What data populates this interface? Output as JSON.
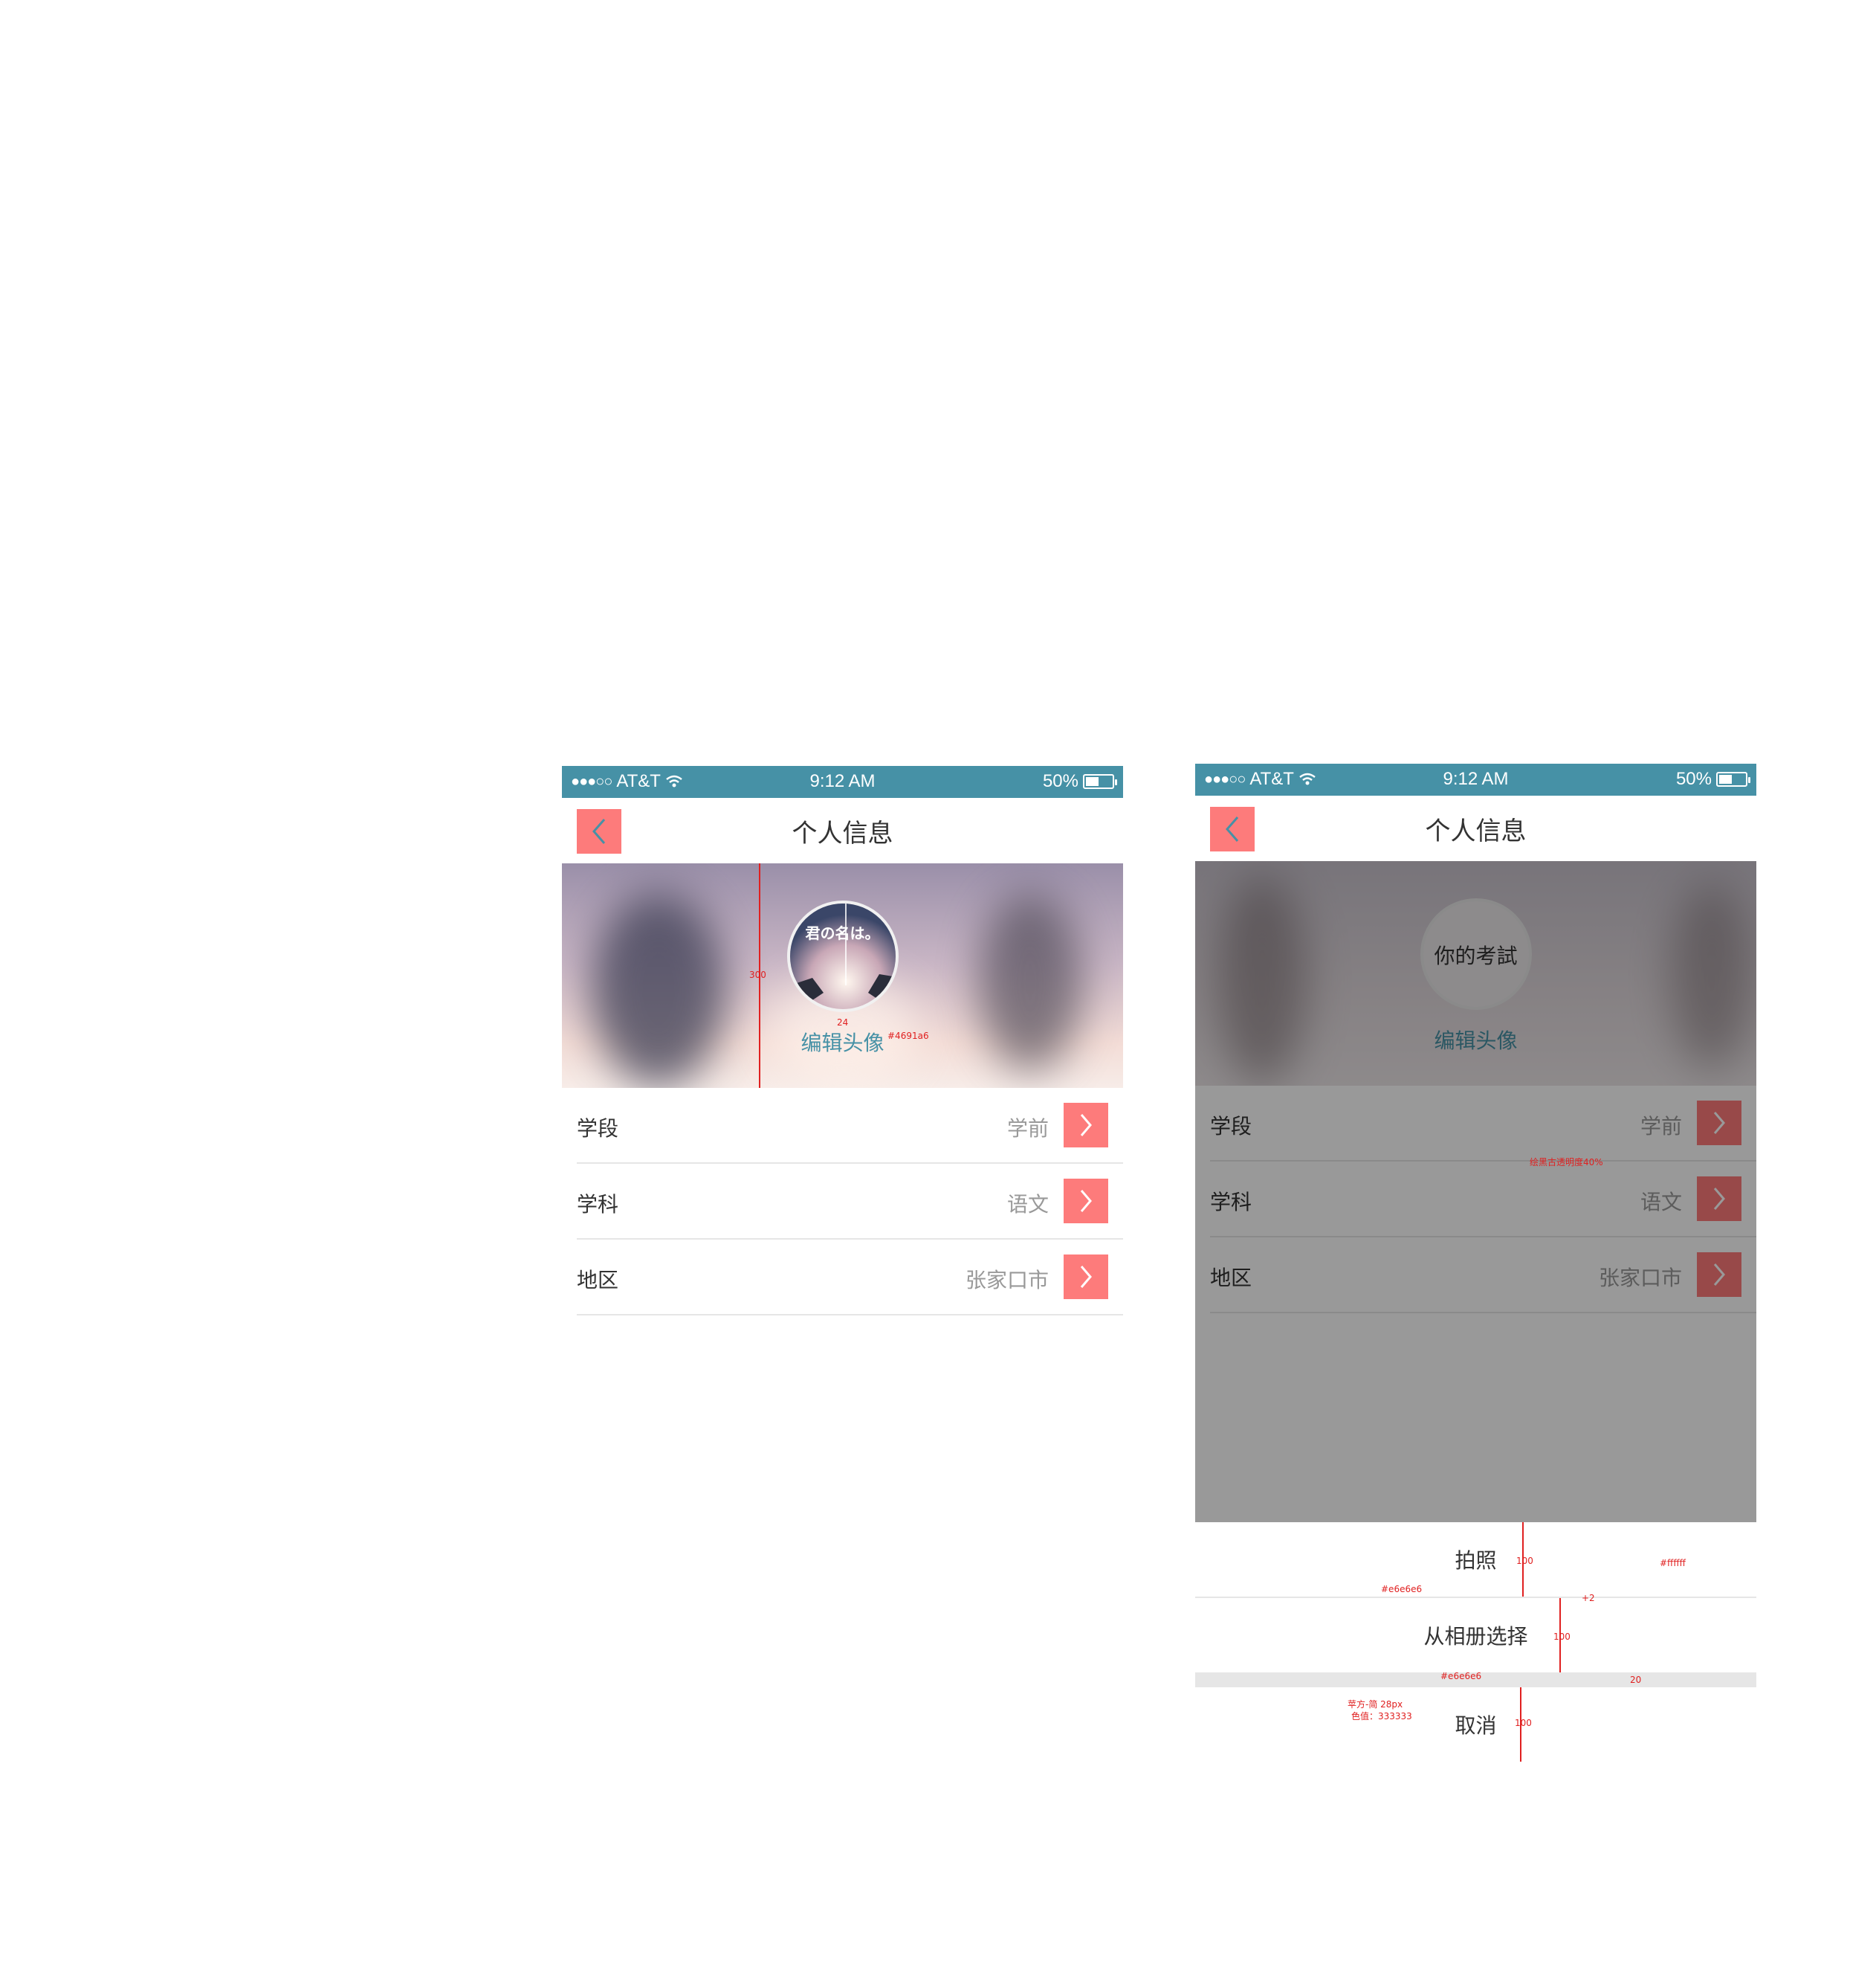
{
  "statusbar": {
    "carrier": "AT&T",
    "signal_dots": "●●●○○",
    "time": "9:12 AM",
    "battery": "50%",
    "battery_level": 0.5
  },
  "navbar": {
    "title": "个人信息"
  },
  "profile": {
    "avatar_title": "君の名は。",
    "edit_label": "编辑头像"
  },
  "profile_b": {
    "avatar_title": "你的考試",
    "edit_label": "编辑头像"
  },
  "list": [
    {
      "label": "学段",
      "value": "学前"
    },
    {
      "label": "学科",
      "value": "语文"
    },
    {
      "label": "地区",
      "value": "张家口市"
    }
  ],
  "sheet": {
    "take_photo": "拍照",
    "from_album": "从相册选择",
    "cancel": "取消"
  },
  "annotations": {
    "banner_height": "300",
    "avatar_gap": "24",
    "edit_color": "#4691a6",
    "overlay_note": "绘黑古透明度40%",
    "sheet_item_height_1": "100",
    "sheet_item_height_2": "100",
    "sheet_item_height_3": "100",
    "divider_thickness": "+2",
    "gap_height": "20",
    "sheet_bg": "#ffffff",
    "divider_color": "#e6e6e6",
    "gap_color": "#e6e6e6",
    "font_spec_1": "苹方-简   28px",
    "font_spec_2": "色值：333333"
  },
  "colors": {
    "primary": "#4691a6",
    "accent": "#fd7b7b",
    "divider": "#e6e6e6",
    "text": "#333333"
  }
}
